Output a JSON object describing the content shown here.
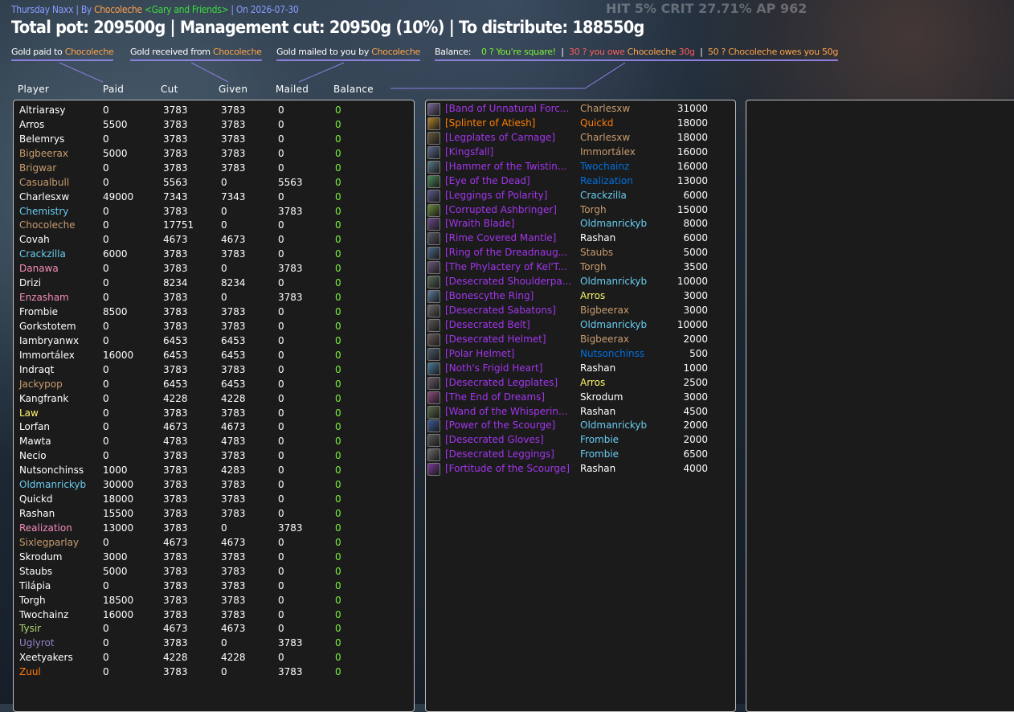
{
  "background_stats": "HIT 5% CRIT 27.71%  AP 962",
  "header": {
    "raid": "Thursday Naxx",
    "sep1": " | ",
    "by_label": "By ",
    "author": "Chocoleche",
    "guild": " <Gary and Friends>",
    "date": " | On 2026-07-30"
  },
  "summary": "Total pot: 209500g | Management cut: 20950g (10%) | To distribute: 188550g",
  "legend": {
    "paid_label": "Gold paid to ",
    "paid_name": "Chocoleche",
    "received_label": "Gold received from ",
    "received_name": "Chocoleche",
    "mailed_label": "Gold mailed to you by ",
    "mailed_name": "Chocoleche",
    "balance_label": "Balance:",
    "balance_zero": "0 ? You're square!",
    "balance_sep": "  |  ",
    "balance_owe_prefix": "30 ? you owe ",
    "balance_owe_name": "Chocoleche",
    "balance_owe_amount": " 30g",
    "balance_sep2": "  |  ",
    "balance_owed": "50 ? Chocoleche owes you 50g"
  },
  "columns": {
    "player": "Player",
    "paid": "Paid",
    "cut": "Cut",
    "given": "Given",
    "mailed": "Mailed",
    "balance": "Balance"
  },
  "colors": {
    "white": "#ffffff",
    "priest": "#ffffff",
    "rogue": "#fff569",
    "mage": "#69ccf0",
    "druid": "#ff7d0a",
    "warrior": "#c79c6e",
    "paladin": "#f58cba",
    "hunter": "#abd473",
    "warlock": "#9482c9",
    "shaman": "#0070de",
    "epic": "#a335ee",
    "legendary": "#ff8000",
    "balance_zero": "#7ef03a"
  },
  "players": [
    {
      "name": "Altriarasy",
      "color": "#ffffff",
      "paid": "0",
      "cut": "3783",
      "given": "3783",
      "mailed": "0",
      "balance": "0"
    },
    {
      "name": "Arros",
      "color": "#ffffff",
      "paid": "5500",
      "cut": "3783",
      "given": "3783",
      "mailed": "0",
      "balance": "0"
    },
    {
      "name": "Belemrys",
      "color": "#ffffff",
      "paid": "0",
      "cut": "3783",
      "given": "3783",
      "mailed": "0",
      "balance": "0"
    },
    {
      "name": "Bigbeerax",
      "color": "#c79c6e",
      "paid": "5000",
      "cut": "3783",
      "given": "3783",
      "mailed": "0",
      "balance": "0"
    },
    {
      "name": "Brigwar",
      "color": "#c79c6e",
      "paid": "0",
      "cut": "3783",
      "given": "3783",
      "mailed": "0",
      "balance": "0"
    },
    {
      "name": "Casualbull",
      "color": "#c79c6e",
      "paid": "0",
      "cut": "5563",
      "given": "0",
      "mailed": "5563",
      "balance": "0"
    },
    {
      "name": "Charlesxw",
      "color": "#ffffff",
      "paid": "49000",
      "cut": "7343",
      "given": "7343",
      "mailed": "0",
      "balance": "0"
    },
    {
      "name": "Chemistry",
      "color": "#69ccf0",
      "paid": "0",
      "cut": "3783",
      "given": "0",
      "mailed": "3783",
      "balance": "0"
    },
    {
      "name": "Chocoleche",
      "color": "#c79c6e",
      "paid": "0",
      "cut": "17751",
      "given": "0",
      "mailed": "0",
      "balance": "0"
    },
    {
      "name": "Covah",
      "color": "#ffffff",
      "paid": "0",
      "cut": "4673",
      "given": "4673",
      "mailed": "0",
      "balance": "0"
    },
    {
      "name": "Crackzilla",
      "color": "#69ccf0",
      "paid": "6000",
      "cut": "3783",
      "given": "3783",
      "mailed": "0",
      "balance": "0"
    },
    {
      "name": "Danawa",
      "color": "#f58cba",
      "paid": "0",
      "cut": "3783",
      "given": "0",
      "mailed": "3783",
      "balance": "0"
    },
    {
      "name": "Drizi",
      "color": "#ffffff",
      "paid": "0",
      "cut": "8234",
      "given": "8234",
      "mailed": "0",
      "balance": "0"
    },
    {
      "name": "Enzasham",
      "color": "#f58cba",
      "paid": "0",
      "cut": "3783",
      "given": "0",
      "mailed": "3783",
      "balance": "0"
    },
    {
      "name": "Frombie",
      "color": "#ffffff",
      "paid": "8500",
      "cut": "3783",
      "given": "3783",
      "mailed": "0",
      "balance": "0"
    },
    {
      "name": "Gorkstotem",
      "color": "#ffffff",
      "paid": "0",
      "cut": "3783",
      "given": "3783",
      "mailed": "0",
      "balance": "0"
    },
    {
      "name": "Iambryanwx",
      "color": "#ffffff",
      "paid": "0",
      "cut": "6453",
      "given": "6453",
      "mailed": "0",
      "balance": "0"
    },
    {
      "name": "Immortálex",
      "color": "#ffffff",
      "paid": "16000",
      "cut": "6453",
      "given": "6453",
      "mailed": "0",
      "balance": "0"
    },
    {
      "name": "Indraqt",
      "color": "#ffffff",
      "paid": "0",
      "cut": "3783",
      "given": "3783",
      "mailed": "0",
      "balance": "0"
    },
    {
      "name": "Jackypop",
      "color": "#c79c6e",
      "paid": "0",
      "cut": "6453",
      "given": "6453",
      "mailed": "0",
      "balance": "0"
    },
    {
      "name": "Kangfrank",
      "color": "#ffffff",
      "paid": "0",
      "cut": "4228",
      "given": "4228",
      "mailed": "0",
      "balance": "0"
    },
    {
      "name": "Law",
      "color": "#fff569",
      "paid": "0",
      "cut": "3783",
      "given": "3783",
      "mailed": "0",
      "balance": "0"
    },
    {
      "name": "Lorfan",
      "color": "#ffffff",
      "paid": "0",
      "cut": "4673",
      "given": "4673",
      "mailed": "0",
      "balance": "0"
    },
    {
      "name": "Mawta",
      "color": "#ffffff",
      "paid": "0",
      "cut": "4783",
      "given": "4783",
      "mailed": "0",
      "balance": "0"
    },
    {
      "name": "Necio",
      "color": "#ffffff",
      "paid": "0",
      "cut": "3783",
      "given": "3783",
      "mailed": "0",
      "balance": "0"
    },
    {
      "name": "Nutsonchinss",
      "color": "#ffffff",
      "paid": "1000",
      "cut": "3783",
      "given": "4283",
      "mailed": "0",
      "balance": "0"
    },
    {
      "name": "Oldmanrickyb",
      "color": "#69ccf0",
      "paid": "30000",
      "cut": "3783",
      "given": "3783",
      "mailed": "0",
      "balance": "0"
    },
    {
      "name": "Quickd",
      "color": "#ffffff",
      "paid": "18000",
      "cut": "3783",
      "given": "3783",
      "mailed": "0",
      "balance": "0"
    },
    {
      "name": "Rashan",
      "color": "#ffffff",
      "paid": "15500",
      "cut": "3783",
      "given": "3783",
      "mailed": "0",
      "balance": "0"
    },
    {
      "name": "Realization",
      "color": "#f58cba",
      "paid": "13000",
      "cut": "3783",
      "given": "0",
      "mailed": "3783",
      "balance": "0"
    },
    {
      "name": "Sixlegparlay",
      "color": "#c79c6e",
      "paid": "0",
      "cut": "4673",
      "given": "4673",
      "mailed": "0",
      "balance": "0"
    },
    {
      "name": "Skrodum",
      "color": "#ffffff",
      "paid": "3000",
      "cut": "3783",
      "given": "3783",
      "mailed": "0",
      "balance": "0"
    },
    {
      "name": "Staubs",
      "color": "#ffffff",
      "paid": "5000",
      "cut": "3783",
      "given": "3783",
      "mailed": "0",
      "balance": "0"
    },
    {
      "name": "Tilápia",
      "color": "#ffffff",
      "paid": "0",
      "cut": "3783",
      "given": "3783",
      "mailed": "0",
      "balance": "0"
    },
    {
      "name": "Torgh",
      "color": "#ffffff",
      "paid": "18500",
      "cut": "3783",
      "given": "3783",
      "mailed": "0",
      "balance": "0"
    },
    {
      "name": "Twochainz",
      "color": "#ffffff",
      "paid": "16000",
      "cut": "3783",
      "given": "3783",
      "mailed": "0",
      "balance": "0"
    },
    {
      "name": "Tysir",
      "color": "#abd473",
      "paid": "0",
      "cut": "4673",
      "given": "4673",
      "mailed": "0",
      "balance": "0"
    },
    {
      "name": "Uglyrot",
      "color": "#9482c9",
      "paid": "0",
      "cut": "3783",
      "given": "0",
      "mailed": "3783",
      "balance": "0"
    },
    {
      "name": "Xeetyakers",
      "color": "#ffffff",
      "paid": "0",
      "cut": "4228",
      "given": "4228",
      "mailed": "0",
      "balance": "0"
    },
    {
      "name": "Zuul",
      "color": "#ff7d0a",
      "paid": "0",
      "cut": "3783",
      "given": "0",
      "mailed": "3783",
      "balance": "0"
    }
  ],
  "items": [
    {
      "icon": "ring-icon",
      "icon_color": "#7a6a9a",
      "name": "[Band of Unnatural Forc...",
      "quality": "epic",
      "winner": "Charlesxw",
      "winner_color": "#c79c6e",
      "price": "31000"
    },
    {
      "icon": "splinter-icon",
      "icon_color": "#b0802a",
      "name": "[Splinter of Atiesh]",
      "quality": "legendary",
      "winner": "Quickd",
      "winner_color": "#ff7d0a",
      "price": "18000"
    },
    {
      "icon": "legplates-icon",
      "icon_color": "#6a5a3a",
      "name": "[Legplates of Carnage]",
      "quality": "epic",
      "winner": "Charlesxw",
      "winner_color": "#c79c6e",
      "price": "18000"
    },
    {
      "icon": "sword-icon",
      "icon_color": "#5a6a8a",
      "name": "[Kingsfall]",
      "quality": "epic",
      "winner": "Immortálex",
      "winner_color": "#c79c6e",
      "price": "16000"
    },
    {
      "icon": "hammer-icon",
      "icon_color": "#5a7a8a",
      "name": "[Hammer of the Twistin...",
      "quality": "epic",
      "winner": "Twochainz",
      "winner_color": "#0070de",
      "price": "16000"
    },
    {
      "icon": "eye-icon",
      "icon_color": "#4a8a5a",
      "name": "[Eye of the Dead]",
      "quality": "epic",
      "winner": "Realization",
      "winner_color": "#0070de",
      "price": "13000"
    },
    {
      "icon": "leggings-icon",
      "icon_color": "#5a5a8a",
      "name": "[Leggings of Polarity]",
      "quality": "epic",
      "winner": "Crackzilla",
      "winner_color": "#69ccf0",
      "price": "6000"
    },
    {
      "icon": "ashbringer-icon",
      "icon_color": "#6a8a3a",
      "name": "[Corrupted Ashbringer]",
      "quality": "epic",
      "winner": "Torgh",
      "winner_color": "#c79c6e",
      "price": "15000"
    },
    {
      "icon": "blade-icon",
      "icon_color": "#6a4a8a",
      "name": "[Wraith Blade]",
      "quality": "epic",
      "winner": "Oldmanrickyb",
      "winner_color": "#69ccf0",
      "price": "8000"
    },
    {
      "icon": "mantle-icon",
      "icon_color": "#5a5a6a",
      "name": "[Rime Covered Mantle]",
      "quality": "epic",
      "winner": "Rashan",
      "winner_color": "#ffffff",
      "price": "6000"
    },
    {
      "icon": "ring-icon",
      "icon_color": "#4a6a8a",
      "name": "[Ring of the Dreadnaug...",
      "quality": "epic",
      "winner": "Staubs",
      "winner_color": "#c79c6e",
      "price": "5000"
    },
    {
      "icon": "phylactery-icon",
      "icon_color": "#6a5a7a",
      "name": "[The Phylactery of Kel'T...",
      "quality": "epic",
      "winner": "Torgh",
      "winner_color": "#c79c6e",
      "price": "3500"
    },
    {
      "icon": "shoulder-icon",
      "icon_color": "#5a6a5a",
      "name": "[Desecrated Shoulderpa...",
      "quality": "epic",
      "winner": "Oldmanrickyb",
      "winner_color": "#69ccf0",
      "price": "10000"
    },
    {
      "icon": "ring-icon",
      "icon_color": "#5a7a9a",
      "name": "[Bonescythe Ring]",
      "quality": "epic",
      "winner": "Arros",
      "winner_color": "#fff569",
      "price": "3000"
    },
    {
      "icon": "boots-icon",
      "icon_color": "#6a6a6a",
      "name": "[Desecrated Sabatons]",
      "quality": "epic",
      "winner": "Bigbeerax",
      "winner_color": "#c79c6e",
      "price": "3000"
    },
    {
      "icon": "belt-icon",
      "icon_color": "#5a5a5a",
      "name": "[Desecrated Belt]",
      "quality": "epic",
      "winner": "Oldmanrickyb",
      "winner_color": "#69ccf0",
      "price": "10000"
    },
    {
      "icon": "helmet-icon",
      "icon_color": "#6a5a5a",
      "name": "[Desecrated Helmet]",
      "quality": "epic",
      "winner": "Bigbeerax",
      "winner_color": "#c79c6e",
      "price": "2000"
    },
    {
      "icon": "helmet-icon",
      "icon_color": "#4a5a6a",
      "name": "[Polar Helmet]",
      "quality": "epic",
      "winner": "Nutsonchinss",
      "winner_color": "#0070de",
      "price": "500"
    },
    {
      "icon": "heart-icon",
      "icon_color": "#4a7a9a",
      "name": "[Noth's Frigid Heart]",
      "quality": "epic",
      "winner": "Rashan",
      "winner_color": "#ffffff",
      "price": "1000"
    },
    {
      "icon": "legplates-icon",
      "icon_color": "#6a5a6a",
      "name": "[Desecrated Legplates]",
      "quality": "epic",
      "winner": "Arros",
      "winner_color": "#fff569",
      "price": "2500"
    },
    {
      "icon": "dagger-icon",
      "icon_color": "#8a4a7a",
      "name": "[The End of Dreams]",
      "quality": "epic",
      "winner": "Skrodum",
      "winner_color": "#ffffff",
      "price": "3000"
    },
    {
      "icon": "wand-icon",
      "icon_color": "#5a6a4a",
      "name": "[Wand of the Whisperin...",
      "quality": "epic",
      "winner": "Rashan",
      "winner_color": "#ffffff",
      "price": "4500"
    },
    {
      "icon": "scourge-icon",
      "icon_color": "#3a5a9a",
      "name": "[Power of the Scourge]",
      "quality": "epic",
      "winner": "Oldmanrickyb",
      "winner_color": "#69ccf0",
      "price": "2000"
    },
    {
      "icon": "gloves-icon",
      "icon_color": "#5a5a5a",
      "name": "[Desecrated Gloves]",
      "quality": "epic",
      "winner": "Frombie",
      "winner_color": "#69ccf0",
      "price": "2000"
    },
    {
      "icon": "leggings-icon",
      "icon_color": "#6a6a6a",
      "name": "[Desecrated Leggings]",
      "quality": "epic",
      "winner": "Frombie",
      "winner_color": "#69ccf0",
      "price": "6500"
    },
    {
      "icon": "scourge-icon",
      "icon_color": "#7a3a9a",
      "name": "[Fortitude of the Scourge]",
      "quality": "epic",
      "winner": "Rashan",
      "winner_color": "#ffffff",
      "price": "4000"
    }
  ]
}
